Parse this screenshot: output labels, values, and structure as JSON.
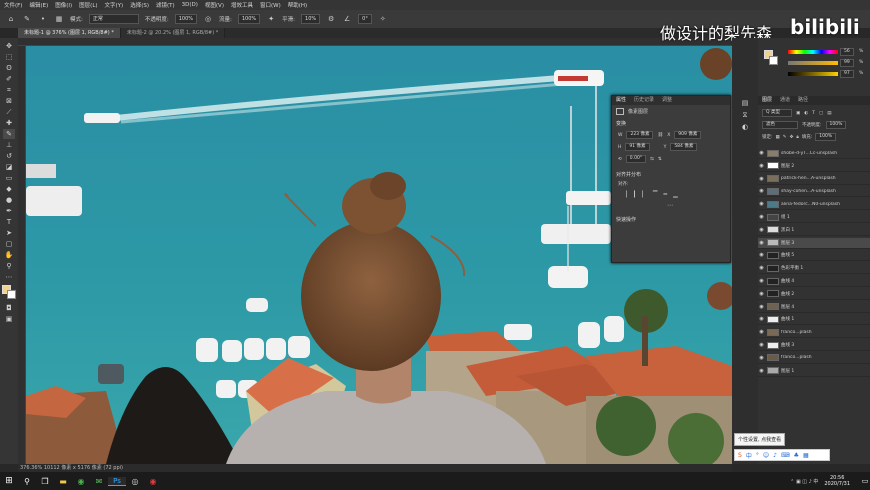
{
  "menu": [
    "文件(F)",
    "编辑(E)",
    "图像(I)",
    "图层(L)",
    "文字(Y)",
    "选择(S)",
    "滤镜(T)",
    "3D(D)",
    "视图(V)",
    "增效工具",
    "窗口(W)",
    "帮助(H)"
  ],
  "options": {
    "mode_label": "模式:",
    "mode_value": "正常",
    "opacity_label": "不透明度:",
    "opacity_value": "100%",
    "flow_label": "流量:",
    "flow_value": "100%",
    "smooth_label": "平滑:",
    "smooth_value": "10%",
    "angle_value": "0°"
  },
  "watermark": {
    "text": "做设计的梨先森",
    "logo": "bilibili"
  },
  "tabs": [
    {
      "label": "未标题-1 @ 376% (图层 1, RGB/8#) *",
      "active": true
    },
    {
      "label": "未标题-2 @ 20.2% (图层 1, RGB/8#) *",
      "active": false
    }
  ],
  "status": "376.36%   10112 像素 x 5176 像素 (72 ppi)",
  "properties": {
    "tabs": [
      "属性",
      "历史记录",
      "调整"
    ],
    "header": "像素图层",
    "transform_label": "变换",
    "w_label": "W",
    "w_value": "223 像素",
    "x_label": "X",
    "x_value": "909 像素",
    "h_label": "H",
    "h_value": "91 像素",
    "y_label": "Y",
    "y_value": "584 像素",
    "angle_value": "0.00°",
    "align_label": "对齐并分布",
    "align_sub": "对齐:",
    "quick_label": "快速操作"
  },
  "color_panel": {
    "h": "56",
    "s": "99",
    "b": "97",
    "units": [
      "%",
      "%",
      "%"
    ]
  },
  "layers_panel": {
    "tabs": [
      "图层",
      "通道",
      "路径"
    ],
    "kind_label": "Q 类型",
    "blend_value": "滤色",
    "opacity_label": "不透明度:",
    "opacity_value": "100%",
    "lock_label": "锁定:",
    "fill_label": "填充:",
    "fill_value": "100%",
    "rows": [
      {
        "name": "shobe-d-yT...Cc-unsplash",
        "thumb": "#8a7d6a"
      },
      {
        "name": "图层 2",
        "thumb": "#ffffff"
      },
      {
        "name": "patrick-hen...A-unsplash",
        "thumb": "#7a6e5c"
      },
      {
        "name": "shay-cohen...A-unsplash",
        "thumb": "#5b6e7a"
      },
      {
        "name": "alina-fedorc...N0-unsplash",
        "thumb": "#4d7a8a"
      },
      {
        "name": "组 1",
        "thumb": "#444444"
      },
      {
        "name": "黑白 1",
        "thumb": "#dddddd"
      },
      {
        "name": "图层 3",
        "thumb": "#bbbbbb"
      },
      {
        "name": "曲线 5",
        "thumb": "#222222"
      },
      {
        "name": "色彩平衡 1",
        "thumb": "#222222"
      },
      {
        "name": "曲线 4",
        "thumb": "#222222"
      },
      {
        "name": "曲线 2",
        "thumb": "#222222"
      },
      {
        "name": "图层 4",
        "thumb": "#6e6252"
      },
      {
        "name": "曲线 1",
        "thumb": "#eeeeee"
      },
      {
        "name": "franco...plash",
        "thumb": "#7a6a55"
      },
      {
        "name": "曲线 3",
        "thumb": "#eeeeee"
      },
      {
        "name": "franco...plash",
        "thumb": "#6a5a46"
      },
      {
        "name": "图层 1",
        "thumb": "#aaaaaa"
      }
    ]
  },
  "tooltip": "个性设置, 点我查看",
  "taskbar": {
    "time": "20:56",
    "date": "2020/7/31"
  },
  "colors": {
    "water": "#2f8ea0",
    "roof": "#c8603a",
    "hair": "#7a5234",
    "shirt": "#b6b1ae"
  }
}
